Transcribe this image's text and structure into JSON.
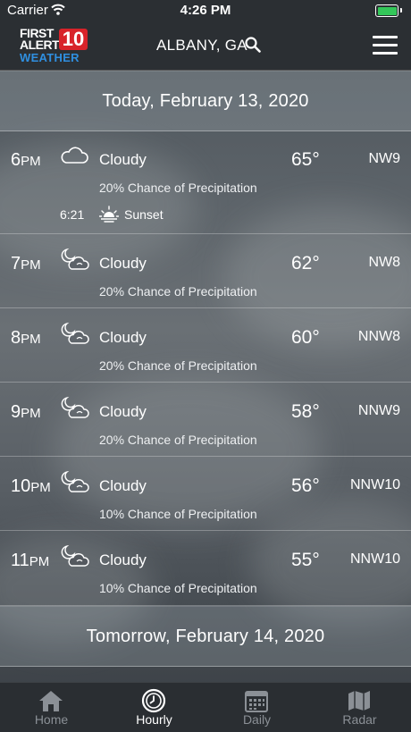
{
  "status_bar": {
    "carrier": "Carrier",
    "time": "4:26 PM"
  },
  "header": {
    "logo": {
      "line1": "FIRST",
      "line2": "ALERT",
      "number": "10",
      "line3": "WEATHER"
    },
    "location": "ALBANY, GA"
  },
  "days": [
    {
      "title": "Today, February 13, 2020"
    },
    {
      "title": "Tomorrow, February 14, 2020"
    }
  ],
  "hours": [
    {
      "hour": "6",
      "ampm": "PM",
      "icon": "cloud-icon",
      "condition": "Cloudy",
      "temp": "65°",
      "wind": "NW9",
      "precip": "20% Chance of Precipitation"
    },
    {
      "hour": "7",
      "ampm": "PM",
      "icon": "night-cloudy-icon",
      "condition": "Cloudy",
      "temp": "62°",
      "wind": "NW8",
      "precip": "20% Chance of Precipitation"
    },
    {
      "hour": "8",
      "ampm": "PM",
      "icon": "night-cloudy-icon",
      "condition": "Cloudy",
      "temp": "60°",
      "wind": "NNW8",
      "precip": "20% Chance of Precipitation"
    },
    {
      "hour": "9",
      "ampm": "PM",
      "icon": "night-cloudy-icon",
      "condition": "Cloudy",
      "temp": "58°",
      "wind": "NNW9",
      "precip": "20% Chance of Precipitation"
    },
    {
      "hour": "10",
      "ampm": "PM",
      "icon": "night-cloudy-icon",
      "condition": "Cloudy",
      "temp": "56°",
      "wind": "NNW10",
      "precip": "10% Chance of Precipitation"
    },
    {
      "hour": "11",
      "ampm": "PM",
      "icon": "night-cloudy-icon",
      "condition": "Cloudy",
      "temp": "55°",
      "wind": "NNW10",
      "precip": "10% Chance of Precipitation"
    }
  ],
  "sunset": {
    "time": "6:21",
    "label": "Sunset",
    "icon": "sunset-icon"
  },
  "tabs": [
    {
      "label": "Home",
      "icon": "home-icon",
      "active": false
    },
    {
      "label": "Hourly",
      "icon": "clock-icon",
      "active": true
    },
    {
      "label": "Daily",
      "icon": "calendar-icon",
      "active": false
    },
    {
      "label": "Radar",
      "icon": "map-icon",
      "active": false
    }
  ],
  "colors": {
    "logo_red": "#d8232a",
    "logo_blue": "#2f8fe0",
    "battery_green": "#33c759",
    "tab_inactive": "#8b9096",
    "tab_active": "#ffffff"
  }
}
